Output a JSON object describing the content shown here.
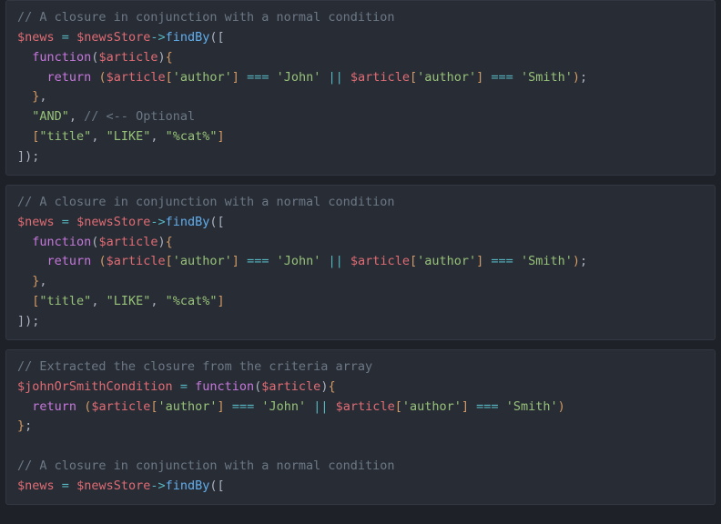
{
  "blocks": [
    {
      "lines": [
        [
          {
            "t": "c",
            "x": "// A closure in conjunction with a normal condition"
          }
        ],
        [
          {
            "t": "v",
            "x": "$news"
          },
          {
            "t": "p",
            "x": " "
          },
          {
            "t": "op",
            "x": "="
          },
          {
            "t": "p",
            "x": " "
          },
          {
            "t": "v",
            "x": "$newsStore"
          },
          {
            "t": "op",
            "x": "->"
          },
          {
            "t": "fn",
            "x": "findBy"
          },
          {
            "t": "p",
            "x": "(["
          }
        ],
        [
          {
            "t": "p",
            "x": "  "
          },
          {
            "t": "kw",
            "x": "function"
          },
          {
            "t": "p",
            "x": "("
          },
          {
            "t": "v",
            "x": "$article"
          },
          {
            "t": "p",
            "x": ")"
          },
          {
            "t": "br",
            "x": "{"
          }
        ],
        [
          {
            "t": "p",
            "x": "    "
          },
          {
            "t": "kw",
            "x": "return"
          },
          {
            "t": "p",
            "x": " "
          },
          {
            "t": "br",
            "x": "("
          },
          {
            "t": "v",
            "x": "$article"
          },
          {
            "t": "br",
            "x": "["
          },
          {
            "t": "s",
            "x": "'author'"
          },
          {
            "t": "br",
            "x": "]"
          },
          {
            "t": "p",
            "x": " "
          },
          {
            "t": "op",
            "x": "==="
          },
          {
            "t": "p",
            "x": " "
          },
          {
            "t": "s",
            "x": "'John'"
          },
          {
            "t": "p",
            "x": " "
          },
          {
            "t": "op",
            "x": "||"
          },
          {
            "t": "p",
            "x": " "
          },
          {
            "t": "v",
            "x": "$article"
          },
          {
            "t": "br",
            "x": "["
          },
          {
            "t": "s",
            "x": "'author'"
          },
          {
            "t": "br",
            "x": "]"
          },
          {
            "t": "p",
            "x": " "
          },
          {
            "t": "op",
            "x": "==="
          },
          {
            "t": "p",
            "x": " "
          },
          {
            "t": "s",
            "x": "'Smith'"
          },
          {
            "t": "br",
            "x": ")"
          },
          {
            "t": "p",
            "x": ";"
          }
        ],
        [
          {
            "t": "p",
            "x": "  "
          },
          {
            "t": "br",
            "x": "}"
          },
          {
            "t": "p",
            "x": ","
          }
        ],
        [
          {
            "t": "p",
            "x": "  "
          },
          {
            "t": "s",
            "x": "\"AND\""
          },
          {
            "t": "p",
            "x": ", "
          },
          {
            "t": "c",
            "x": "// <-- Optional"
          }
        ],
        [
          {
            "t": "p",
            "x": "  "
          },
          {
            "t": "br",
            "x": "["
          },
          {
            "t": "s",
            "x": "\"title\""
          },
          {
            "t": "p",
            "x": ", "
          },
          {
            "t": "s",
            "x": "\"LIKE\""
          },
          {
            "t": "p",
            "x": ", "
          },
          {
            "t": "s",
            "x": "\"%cat%\""
          },
          {
            "t": "br",
            "x": "]"
          }
        ],
        [
          {
            "t": "p",
            "x": "]);"
          }
        ]
      ]
    },
    {
      "lines": [
        [
          {
            "t": "c",
            "x": "// A closure in conjunction with a normal condition"
          }
        ],
        [
          {
            "t": "v",
            "x": "$news"
          },
          {
            "t": "p",
            "x": " "
          },
          {
            "t": "op",
            "x": "="
          },
          {
            "t": "p",
            "x": " "
          },
          {
            "t": "v",
            "x": "$newsStore"
          },
          {
            "t": "op",
            "x": "->"
          },
          {
            "t": "fn",
            "x": "findBy"
          },
          {
            "t": "p",
            "x": "(["
          }
        ],
        [
          {
            "t": "p",
            "x": "  "
          },
          {
            "t": "kw",
            "x": "function"
          },
          {
            "t": "p",
            "x": "("
          },
          {
            "t": "v",
            "x": "$article"
          },
          {
            "t": "p",
            "x": ")"
          },
          {
            "t": "br",
            "x": "{"
          }
        ],
        [
          {
            "t": "p",
            "x": "    "
          },
          {
            "t": "kw",
            "x": "return"
          },
          {
            "t": "p",
            "x": " "
          },
          {
            "t": "br",
            "x": "("
          },
          {
            "t": "v",
            "x": "$article"
          },
          {
            "t": "br",
            "x": "["
          },
          {
            "t": "s",
            "x": "'author'"
          },
          {
            "t": "br",
            "x": "]"
          },
          {
            "t": "p",
            "x": " "
          },
          {
            "t": "op",
            "x": "==="
          },
          {
            "t": "p",
            "x": " "
          },
          {
            "t": "s",
            "x": "'John'"
          },
          {
            "t": "p",
            "x": " "
          },
          {
            "t": "op",
            "x": "||"
          },
          {
            "t": "p",
            "x": " "
          },
          {
            "t": "v",
            "x": "$article"
          },
          {
            "t": "br",
            "x": "["
          },
          {
            "t": "s",
            "x": "'author'"
          },
          {
            "t": "br",
            "x": "]"
          },
          {
            "t": "p",
            "x": " "
          },
          {
            "t": "op",
            "x": "==="
          },
          {
            "t": "p",
            "x": " "
          },
          {
            "t": "s",
            "x": "'Smith'"
          },
          {
            "t": "br",
            "x": ")"
          },
          {
            "t": "p",
            "x": ";"
          }
        ],
        [
          {
            "t": "p",
            "x": "  "
          },
          {
            "t": "br",
            "x": "}"
          },
          {
            "t": "p",
            "x": ","
          }
        ],
        [
          {
            "t": "p",
            "x": "  "
          },
          {
            "t": "br",
            "x": "["
          },
          {
            "t": "s",
            "x": "\"title\""
          },
          {
            "t": "p",
            "x": ", "
          },
          {
            "t": "s",
            "x": "\"LIKE\""
          },
          {
            "t": "p",
            "x": ", "
          },
          {
            "t": "s",
            "x": "\"%cat%\""
          },
          {
            "t": "br",
            "x": "]"
          }
        ],
        [
          {
            "t": "p",
            "x": "]);"
          }
        ]
      ]
    },
    {
      "lines": [
        [
          {
            "t": "c",
            "x": "// Extracted the closure from the criteria array"
          }
        ],
        [
          {
            "t": "v",
            "x": "$johnOrSmithCondition"
          },
          {
            "t": "p",
            "x": " "
          },
          {
            "t": "op",
            "x": "="
          },
          {
            "t": "p",
            "x": " "
          },
          {
            "t": "kw",
            "x": "function"
          },
          {
            "t": "p",
            "x": "("
          },
          {
            "t": "v",
            "x": "$article"
          },
          {
            "t": "p",
            "x": ")"
          },
          {
            "t": "br",
            "x": "{"
          }
        ],
        [
          {
            "t": "p",
            "x": "  "
          },
          {
            "t": "kw",
            "x": "return"
          },
          {
            "t": "p",
            "x": " "
          },
          {
            "t": "br",
            "x": "("
          },
          {
            "t": "v",
            "x": "$article"
          },
          {
            "t": "br",
            "x": "["
          },
          {
            "t": "s",
            "x": "'author'"
          },
          {
            "t": "br",
            "x": "]"
          },
          {
            "t": "p",
            "x": " "
          },
          {
            "t": "op",
            "x": "==="
          },
          {
            "t": "p",
            "x": " "
          },
          {
            "t": "s",
            "x": "'John'"
          },
          {
            "t": "p",
            "x": " "
          },
          {
            "t": "op",
            "x": "||"
          },
          {
            "t": "p",
            "x": " "
          },
          {
            "t": "v",
            "x": "$article"
          },
          {
            "t": "br",
            "x": "["
          },
          {
            "t": "s",
            "x": "'author'"
          },
          {
            "t": "br",
            "x": "]"
          },
          {
            "t": "p",
            "x": " "
          },
          {
            "t": "op",
            "x": "==="
          },
          {
            "t": "p",
            "x": " "
          },
          {
            "t": "s",
            "x": "'Smith'"
          },
          {
            "t": "br",
            "x": ")"
          }
        ],
        [
          {
            "t": "br",
            "x": "}"
          },
          {
            "t": "p",
            "x": ";"
          }
        ],
        [
          {
            "t": "p",
            "x": ""
          }
        ],
        [
          {
            "t": "c",
            "x": "// A closure in conjunction with a normal condition"
          }
        ],
        [
          {
            "t": "v",
            "x": "$news"
          },
          {
            "t": "p",
            "x": " "
          },
          {
            "t": "op",
            "x": "="
          },
          {
            "t": "p",
            "x": " "
          },
          {
            "t": "v",
            "x": "$newsStore"
          },
          {
            "t": "op",
            "x": "->"
          },
          {
            "t": "fn",
            "x": "findBy"
          },
          {
            "t": "p",
            "x": "(["
          }
        ]
      ]
    }
  ]
}
